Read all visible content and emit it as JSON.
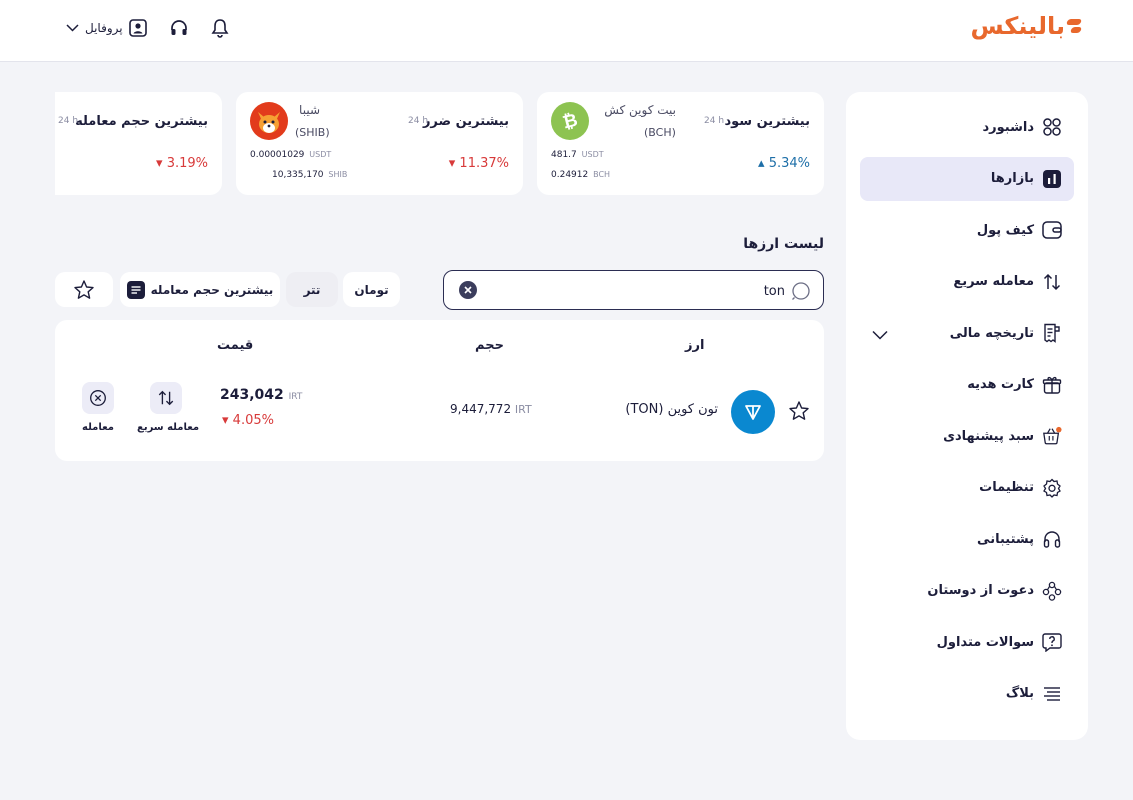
{
  "header": {
    "logo_text": "بالینکس",
    "profile_label": "پروفایل"
  },
  "sidebar": {
    "items": [
      {
        "label": "داشبورد",
        "icon": "dashboard-icon"
      },
      {
        "label": "بازارها",
        "icon": "chart-icon",
        "active": true
      },
      {
        "label": "کیف پول",
        "icon": "wallet-icon"
      },
      {
        "label": "معامله سریع",
        "icon": "swap-icon"
      },
      {
        "label": "تاریخچه مالی",
        "icon": "receipt-icon",
        "expandable": true
      },
      {
        "label": "کارت هدیه",
        "icon": "gift-icon"
      },
      {
        "label": "سبد پیشنهادی",
        "icon": "basket-icon",
        "badge": true
      },
      {
        "label": "تنظیمات",
        "icon": "gear-icon"
      },
      {
        "label": "پشتیبانی",
        "icon": "headset-icon"
      },
      {
        "label": "دعوت از دوستان",
        "icon": "users-icon"
      },
      {
        "label": "سوالات متداول",
        "icon": "question-icon"
      },
      {
        "label": "بلاگ",
        "icon": "blog-icon"
      }
    ]
  },
  "cards": {
    "profit": {
      "title": "بیشترین سود",
      "period": "24 h",
      "change": "5.34%",
      "coin_name": "بیت کوین کش",
      "coin_symbol": "(BCH)",
      "line1_value": "481.7",
      "line1_unit": "USDT",
      "line2_value": "0.24912",
      "line2_unit": "BCH"
    },
    "loss": {
      "title": "بیشترین ضرر",
      "period": "24 h",
      "change": "11.37%",
      "coin_name": "شیبا",
      "coin_symbol": "(SHIB)",
      "line1_value": "0.00001029",
      "line1_unit": "USDT",
      "line2_value": "10,335,170",
      "line2_unit": "SHIB"
    },
    "volume": {
      "title": "بیشترین حجم معامله",
      "period": "24 h",
      "change": "3.19%"
    }
  },
  "market": {
    "title": "لیست ارزها",
    "search_value": "ton",
    "chips": {
      "toman": "تومان",
      "tether": "تتر",
      "sort": "بیشترین حجم معامله"
    },
    "columns": {
      "currency": "ارز",
      "volume": "حجم",
      "price": "قیمت"
    },
    "rows": [
      {
        "name": "تون کوین (TON)",
        "volume": "9,447,772",
        "volume_unit": "IRT",
        "price": "243,042",
        "price_unit": "IRT",
        "change": "4.05%",
        "quick_trade_label": "معامله سریع",
        "trade_label": "معامله"
      }
    ]
  },
  "colors": {
    "brand": "#e8682d",
    "up": "#1e6fa8",
    "down": "#d83a3a",
    "active_bg": "#e8e8f8",
    "ton_blue": "#0a88d0",
    "btc_green": "#8dc351"
  }
}
